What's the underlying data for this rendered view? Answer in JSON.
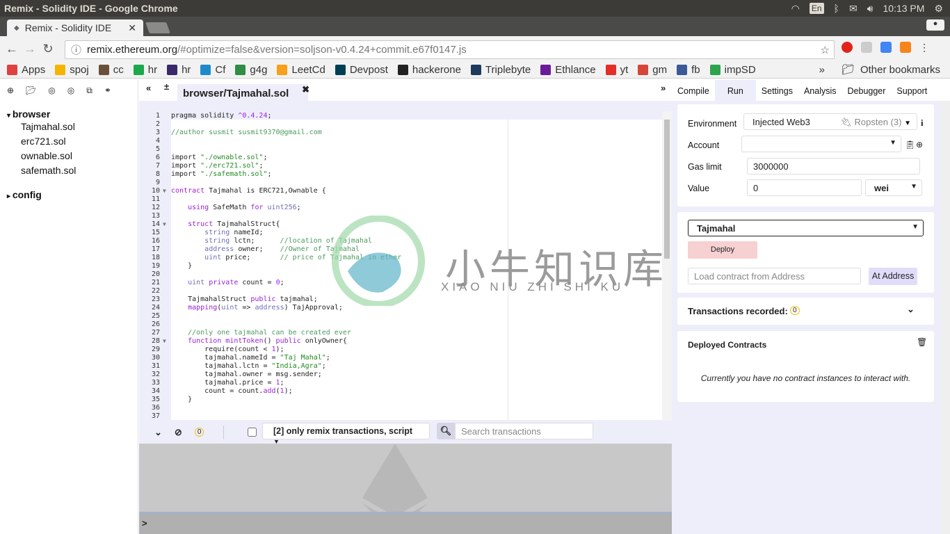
{
  "os": {
    "window_title": "Remix - Solidity IDE - Google Chrome",
    "lang": "En",
    "time": "10:13 PM"
  },
  "browser": {
    "tab_title": "Remix - Solidity IDE",
    "url_host": "remix.ethereum.org",
    "url_rest": "/#optimize=false&version=soljson-v0.4.24+commit.e67f0147.js",
    "bookmarks": [
      {
        "label": "Apps",
        "color": "#e04040"
      },
      {
        "label": "spoj",
        "color": "#f4b400"
      },
      {
        "label": "cc",
        "color": "#6b4f3a"
      },
      {
        "label": "hr",
        "color": "#1ba94c"
      },
      {
        "label": "hr",
        "color": "#39296b"
      },
      {
        "label": "Cf",
        "color": "#1f8acb"
      },
      {
        "label": "g4g",
        "color": "#2f8d46"
      },
      {
        "label": "LeetCd",
        "color": "#f89f1b"
      },
      {
        "label": "Devpost",
        "color": "#003e54"
      },
      {
        "label": "hackerone",
        "color": "#222222"
      },
      {
        "label": "Triplebyte",
        "color": "#1e3a5f"
      },
      {
        "label": "Ethlance",
        "color": "#6a1b9a"
      },
      {
        "label": "yt",
        "color": "#e52d27"
      },
      {
        "label": "gm",
        "color": "#d44638"
      },
      {
        "label": "fb",
        "color": "#3b5998"
      },
      {
        "label": "impSD",
        "color": "#2ea44f"
      }
    ],
    "more": "»",
    "other_bookmarks": "Other bookmarks"
  },
  "files": {
    "folders": [
      {
        "name": "browser",
        "files": [
          "Tajmahal.sol",
          "erc721.sol",
          "ownable.sol",
          "safemath.sol"
        ]
      },
      {
        "name": "config",
        "files": []
      }
    ]
  },
  "editor": {
    "tab": "browser/Tajmahal.sol",
    "lines": [
      [
        [
          "pragma solidity ",
          ""
        ],
        [
          "^0.4.24",
          "n"
        ],
        [
          ";",
          ""
        ]
      ],
      [],
      [
        [
          "//author susmit susmit9370@gmail.com",
          "c"
        ]
      ],
      [],
      [],
      [
        [
          "import ",
          ""
        ],
        [
          "\"./ownable.sol\"",
          "s"
        ],
        [
          ";",
          ""
        ]
      ],
      [
        [
          "import ",
          ""
        ],
        [
          "\"./erc721.sol\"",
          "s"
        ],
        [
          ";",
          ""
        ]
      ],
      [
        [
          "import ",
          ""
        ],
        [
          "\"./safemath.sol\"",
          "s"
        ],
        [
          ";",
          ""
        ]
      ],
      [],
      [
        [
          "contract",
          "k"
        ],
        [
          " Tajmahal is ERC721,Ownable {",
          ""
        ]
      ],
      [],
      [
        [
          "    ",
          ""
        ],
        [
          "using",
          "k"
        ],
        [
          " SafeMath ",
          ""
        ],
        [
          "for",
          "k"
        ],
        [
          " ",
          ""
        ],
        [
          "uint256",
          "t"
        ],
        [
          ";",
          ""
        ]
      ],
      [],
      [
        [
          "    ",
          ""
        ],
        [
          "struct",
          "k"
        ],
        [
          " TajmahalStruct{",
          ""
        ]
      ],
      [
        [
          "        ",
          ""
        ],
        [
          "string",
          "t"
        ],
        [
          " nameId;",
          ""
        ]
      ],
      [
        [
          "        ",
          ""
        ],
        [
          "string",
          "t"
        ],
        [
          " lctn;      ",
          ""
        ],
        [
          "//location of Tajmahal",
          "c"
        ]
      ],
      [
        [
          "        ",
          ""
        ],
        [
          "address",
          "t"
        ],
        [
          " owner;    ",
          ""
        ],
        [
          "//Owner of Tajmahal",
          "c"
        ]
      ],
      [
        [
          "        ",
          ""
        ],
        [
          "uint",
          "t"
        ],
        [
          " price;       ",
          ""
        ],
        [
          "// price of Tajmahal in ether",
          "c"
        ]
      ],
      [
        [
          "    }",
          ""
        ]
      ],
      [],
      [
        [
          "    ",
          ""
        ],
        [
          "uint",
          "t"
        ],
        [
          " ",
          ""
        ],
        [
          "private",
          "k"
        ],
        [
          " count = ",
          ""
        ],
        [
          "0",
          "n"
        ],
        [
          ";",
          ""
        ]
      ],
      [],
      [
        [
          "    TajmahalStruct ",
          ""
        ],
        [
          "public",
          "k"
        ],
        [
          " tajmahal;",
          ""
        ]
      ],
      [
        [
          "    ",
          ""
        ],
        [
          "mapping",
          "k"
        ],
        [
          "(",
          ""
        ],
        [
          "uint",
          "t"
        ],
        [
          " => ",
          ""
        ],
        [
          "address",
          "t"
        ],
        [
          ") TajApproval;",
          ""
        ]
      ],
      [],
      [],
      [
        [
          "    ",
          ""
        ],
        [
          "//only one tajmahal can be created ever",
          "c"
        ]
      ],
      [
        [
          "    ",
          ""
        ],
        [
          "function",
          "k"
        ],
        [
          " ",
          ""
        ],
        [
          "mintToken",
          "k"
        ],
        [
          "() ",
          ""
        ],
        [
          "public",
          "k"
        ],
        [
          " onlyOwner{",
          ""
        ]
      ],
      [
        [
          "        require(count < ",
          ""
        ],
        [
          "1",
          "n"
        ],
        [
          ");",
          ""
        ]
      ],
      [
        [
          "        tajmahal.nameId = ",
          ""
        ],
        [
          "\"Taj Mahal\"",
          "s"
        ],
        [
          ";",
          ""
        ]
      ],
      [
        [
          "        tajmahal.lctn = ",
          ""
        ],
        [
          "\"India,Agra\"",
          "s"
        ],
        [
          ";",
          ""
        ]
      ],
      [
        [
          "        tajmahal.owner = msg.sender;",
          ""
        ]
      ],
      [
        [
          "        tajmahal.price = ",
          ""
        ],
        [
          "1",
          "n"
        ],
        [
          ";",
          ""
        ]
      ],
      [
        [
          "        count = count.",
          ""
        ],
        [
          "add",
          "k"
        ],
        [
          "(",
          ""
        ],
        [
          "1",
          "n"
        ],
        [
          ");",
          ""
        ]
      ],
      [
        [
          "    }",
          ""
        ]
      ],
      [],
      []
    ],
    "foldable_lines": [
      10,
      14,
      28
    ]
  },
  "terminal": {
    "count": "0",
    "filter": "[2] only remix transactions, script",
    "search_placeholder": "Search transactions",
    "prompt": ">"
  },
  "run": {
    "tabs": [
      "Compile",
      "Run",
      "Settings",
      "Analysis",
      "Debugger",
      "Support"
    ],
    "active_tab": "Run",
    "environment_label": "Environment",
    "environment": "Injected Web3",
    "network": "Ropsten (3)",
    "account_label": "Account",
    "account": "",
    "gas_label": "Gas limit",
    "gas": "3000000",
    "value_label": "Value",
    "value": "0",
    "unit": "wei",
    "contract": "Tajmahal",
    "deploy": "Deploy",
    "address_placeholder": "Load contract from Address",
    "at_address": "At Address",
    "tx_recorded": "Transactions recorded:",
    "tx_count": "0",
    "deployed_title": "Deployed Contracts",
    "no_instances": "Currently you have no contract instances to interact with."
  },
  "watermark": {
    "text": "小牛知识库",
    "sub": "XIAO NIU ZHI SHI KU"
  }
}
